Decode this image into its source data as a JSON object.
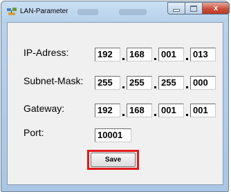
{
  "window": {
    "title": "LAN-Parameter",
    "icon": "network-settings-icon",
    "close_glyph": "x"
  },
  "fields": {
    "ip": {
      "label": "IP-Adress:",
      "octets": [
        "192",
        "168",
        "001",
        "013"
      ]
    },
    "subnet": {
      "label": "Subnet-Mask:",
      "octets": [
        "255",
        "255",
        "255",
        "000"
      ]
    },
    "gateway": {
      "label": "Gateway:",
      "octets": [
        "192",
        "168",
        "001",
        "001"
      ]
    },
    "port": {
      "label": "Port:",
      "value": "10001"
    }
  },
  "actions": {
    "save_label": "Save"
  },
  "colors": {
    "highlight": "#e21b1b",
    "titlebar": "#c9dff2",
    "close_button": "#c8503a"
  }
}
